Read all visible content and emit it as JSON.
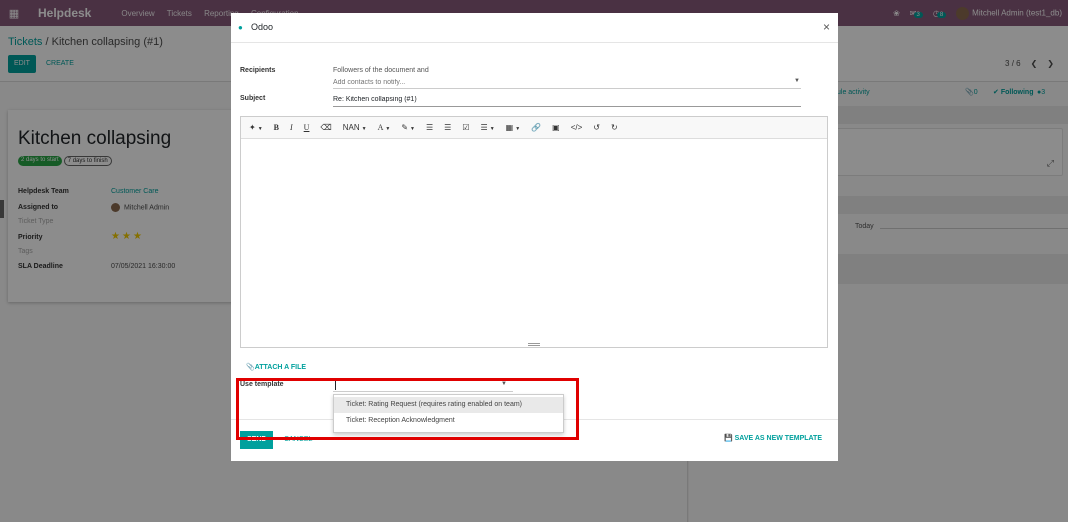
{
  "navbar": {
    "brand": "Helpdesk",
    "menu": [
      "Overview",
      "Tickets",
      "Reporting",
      "Configuration"
    ],
    "activity_count": "3",
    "chat_count": "8",
    "user": "Mitchell Admin (test1_db)"
  },
  "control": {
    "breadcrumb_parent": "Tickets",
    "breadcrumb_sep": "/",
    "breadcrumb_current": "Kitchen collapsing (#1)",
    "edit_label": "EDIT",
    "create_label": "CREATE",
    "pager": "3 / 6"
  },
  "ticket": {
    "title": "Kitchen collapsing",
    "tag_start": "2 days to start",
    "tag_finish": "7 days to finish",
    "fields": {
      "team_label": "Helpdesk Team",
      "team_value": "Customer Care",
      "assigned_label": "Assigned to",
      "assigned_value": "Mitchell Admin",
      "type_label": "Ticket Type",
      "priority_label": "Priority",
      "priority_stars": 3,
      "tags_label": "Tags",
      "sla_label": "SLA Deadline",
      "sla_value": "07/05/2021 16:30:00"
    }
  },
  "chatter": {
    "schedule_activity": "ule activity",
    "attachments_count": "0",
    "following": "Following",
    "followers_count": "3",
    "today_label": "Today"
  },
  "modal": {
    "title": "Odoo",
    "recipients_label": "Recipients",
    "recipients_text": "Followers of the document and",
    "recipients_placeholder": "Add contacts to notify...",
    "subject_label": "Subject",
    "subject_value": "Re: Kitchen collapsing (#1)",
    "toolbar": {
      "font_size": "NAN",
      "text_color": "A"
    },
    "attach_label": "ATTACH A FILE",
    "template_label": "Use template",
    "template_options": [
      "Ticket: Rating Request (requires rating enabled on team)",
      "Ticket: Reception Acknowledgment"
    ],
    "send_label": "SEND",
    "cancel_label": "CANCEL",
    "save_template_label": "SAVE AS NEW TEMPLATE"
  },
  "colors": {
    "brand": "#875a7b",
    "accent": "#00a09d",
    "highlight": "#e00000"
  }
}
